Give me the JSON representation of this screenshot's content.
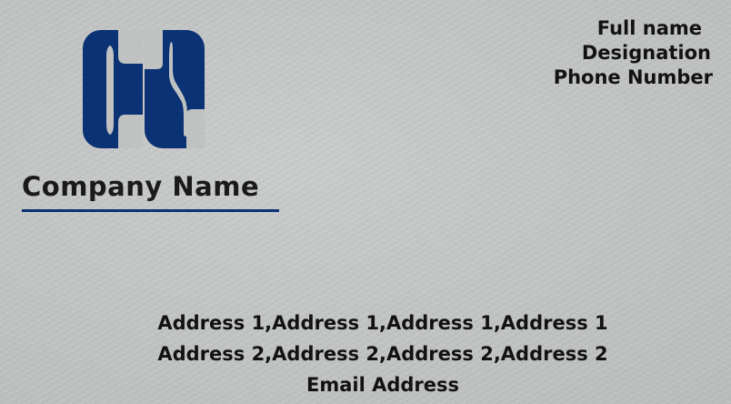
{
  "colors": {
    "brand": "#0b3275",
    "text": "#121212",
    "background": "#bfc2c1"
  },
  "logo": {
    "icon": "cs-monogram-icon"
  },
  "company": {
    "name": "Company Name"
  },
  "contact": {
    "full_name": "Full name",
    "designation": "Designation",
    "phone": "Phone Number"
  },
  "address": {
    "line1": "Address 1,Address 1,Address 1,Address 1",
    "line2": "Address 2,Address 2,Address 2,Address 2",
    "email": "Email Address"
  }
}
